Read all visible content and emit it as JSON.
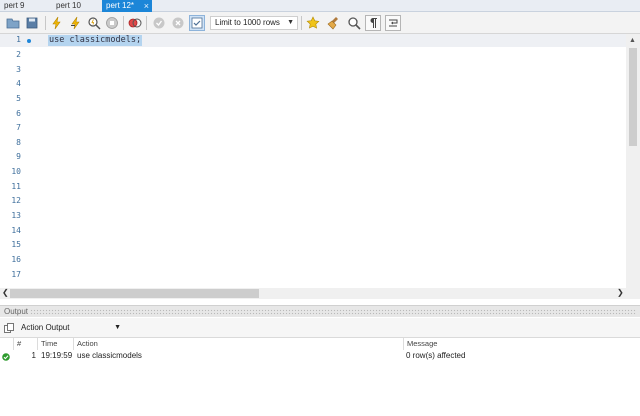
{
  "tabs": [
    {
      "label": "pert 9",
      "active": false
    },
    {
      "label": "pert 10",
      "active": false
    },
    {
      "label": "pert 12*",
      "active": true
    }
  ],
  "toolbar": {
    "limit_value": "Limit to 1000 rows"
  },
  "editor": {
    "lines": [
      "1",
      "2",
      "3",
      "4",
      "5",
      "6",
      "7",
      "8",
      "9",
      "10",
      "11",
      "12",
      "13",
      "14",
      "15",
      "16",
      "17"
    ],
    "code_line_1": "use classicmodels;"
  },
  "output": {
    "panel_title": "Output",
    "selector": "Action Output",
    "columns": {
      "num": "#",
      "time": "Time",
      "action": "Action",
      "message": "Message"
    },
    "rows": [
      {
        "status": "success",
        "num": "1",
        "time": "19:19:59",
        "action": "use classicmodels",
        "message": "0 row(s) affected"
      }
    ]
  },
  "colors": {
    "accent": "#1c86d8",
    "success": "#2e9b2e"
  }
}
